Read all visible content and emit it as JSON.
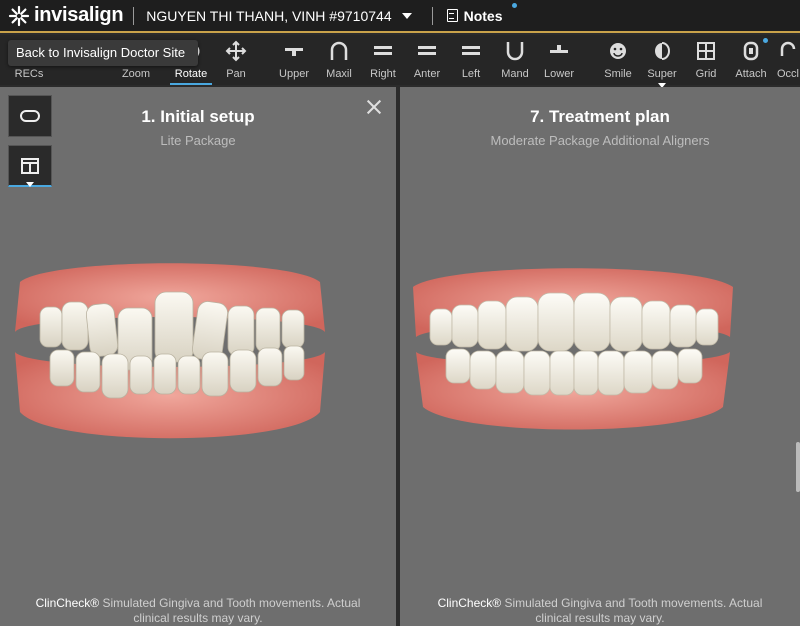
{
  "header": {
    "brand": "invisalign",
    "patient": "NGUYEN THI THANH, VINH #9710744",
    "notes_label": "Notes"
  },
  "tooltip": "Back to Invisalign Doctor Site",
  "toolbar": {
    "tools": [
      {
        "id": "recs",
        "label": "RECs",
        "icon": "recs-icon"
      },
      {
        "id": "zoom",
        "label": "Zoom",
        "icon": "zoom-icon"
      },
      {
        "id": "rotate",
        "label": "Rotate",
        "icon": "rotate-icon",
        "active": true
      },
      {
        "id": "pan",
        "label": "Pan",
        "icon": "pan-icon"
      },
      {
        "id": "upper",
        "label": "Upper",
        "icon": "upper-icon"
      },
      {
        "id": "maxil",
        "label": "Maxil",
        "icon": "maxil-icon"
      },
      {
        "id": "right",
        "label": "Right",
        "icon": "right-icon"
      },
      {
        "id": "anter",
        "label": "Anter",
        "icon": "anter-icon"
      },
      {
        "id": "left",
        "label": "Left",
        "icon": "left-icon"
      },
      {
        "id": "mand",
        "label": "Mand",
        "icon": "mand-icon"
      },
      {
        "id": "lower",
        "label": "Lower",
        "icon": "lower-icon"
      },
      {
        "id": "smile",
        "label": "Smile",
        "icon": "smile-icon"
      },
      {
        "id": "super",
        "label": "Super",
        "icon": "super-icon"
      },
      {
        "id": "grid",
        "label": "Grid",
        "icon": "grid-icon"
      },
      {
        "id": "attach",
        "label": "Attach",
        "icon": "attach-icon"
      },
      {
        "id": "occl",
        "label": "Occl",
        "icon": "occlusion-icon"
      }
    ]
  },
  "left_pane": {
    "title": "1. Initial setup",
    "subtitle": "Lite Package",
    "disclaimer_brand": "ClinCheck®",
    "disclaimer_text": " Simulated Gingiva and Tooth movements. Actual clinical results may vary."
  },
  "right_pane": {
    "title": "7. Treatment plan",
    "subtitle": "Moderate Package Additional Aligners",
    "disclaimer_brand": "ClinCheck®",
    "disclaimer_text": " Simulated Gingiva and Tooth movements. Actual clinical results may vary."
  },
  "colors": {
    "accent": "#4aa8e0",
    "header_bg": "#1e1e1e",
    "toolbar_bg": "#262626",
    "viewport_bg": "#6e6e6e",
    "gum": "#e8837a",
    "tooth": "#f2efe6"
  }
}
